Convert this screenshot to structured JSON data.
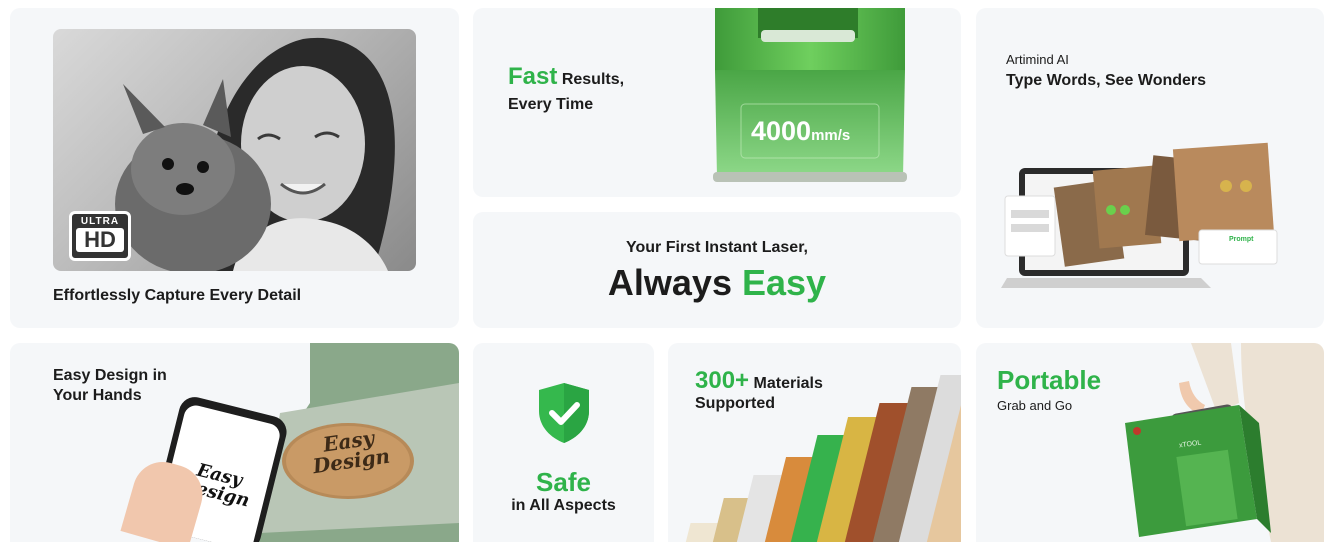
{
  "capture": {
    "caption": "Effortlessly Capture Every Detail",
    "badge_top": "ULTRA",
    "badge_bottom": "HD"
  },
  "fast": {
    "highlight": "Fast",
    "title_rest": "Results,",
    "subtitle": "Every Time",
    "speed_value": "4000",
    "speed_unit": "mm/s"
  },
  "easy": {
    "kicker": "Your First Instant Laser,",
    "headline_dark": "Always",
    "headline_green": "Easy"
  },
  "ai": {
    "kicker": "Artimind AI",
    "title": "Type Words, See Wonders",
    "panel_label": "Prompt"
  },
  "design": {
    "title_line1": "Easy Design in",
    "title_line2": "Your Hands",
    "engraving_line1": "Easy",
    "engraving_line2": "Design"
  },
  "safe": {
    "title": "Safe",
    "subtitle": "in All Aspects",
    "icon": "shield-check-icon"
  },
  "materials": {
    "count": "300+",
    "title_rest": "Materials",
    "subtitle": "Supported"
  },
  "portable": {
    "title": "Portable",
    "subtitle": "Grab and Go",
    "brand": "xTOOL"
  },
  "colors": {
    "accent": "#2fb34a",
    "card_bg": "#f5f7f9",
    "text": "#1c1c1c"
  }
}
